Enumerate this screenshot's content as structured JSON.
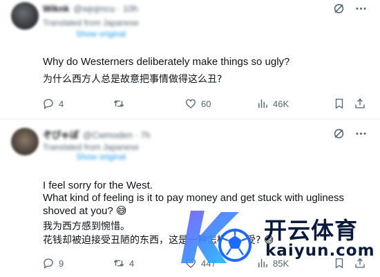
{
  "posts": [
    {
      "author_name": "Wiknk",
      "author_handle": "@wjojmcu · 10h",
      "translated_line": "Translated from Japanese",
      "original_label": "Show original",
      "body_en": "Why do Westerners deliberately make things so ugly?",
      "body_cn": "为什么西方人总是故意把事情做得这么丑?",
      "stats": {
        "replies": "4",
        "reposts": "",
        "likes": "60",
        "views": "46K"
      }
    },
    {
      "author_name": "ぞぴゃぽ",
      "author_handle": "@Cwmoden · 7h",
      "translated_line": "Translated from Japanese",
      "original_label": "Show original",
      "body_en_1": "I feel sorry for the West.",
      "body_en_2": "What kind of feeling is it to pay money and get stuck with ugliness shoved at you? 😅",
      "body_cn_1": "我为西方感到惋惜。",
      "body_cn_2": "花钱却被迫接受丑陋的东西，这是一种怎样的感受? 😅",
      "stats": {
        "replies": "9",
        "reposts": "4",
        "likes": "447",
        "views": "85K"
      }
    }
  ],
  "watermark": {
    "brand_cn": "开云体育",
    "brand_url": "kaiyun.com"
  },
  "icons": {
    "grok": "grok-icon",
    "more": "more-icon",
    "reply": "reply-icon",
    "repost": "repost-icon",
    "like": "like-icon",
    "views": "views-icon",
    "bookmark": "bookmark-icon",
    "share": "share-icon"
  },
  "colors": {
    "text": "#0f1419",
    "muted": "#536471",
    "link": "#1d9bf0",
    "watermark": "#0a1a3a"
  }
}
